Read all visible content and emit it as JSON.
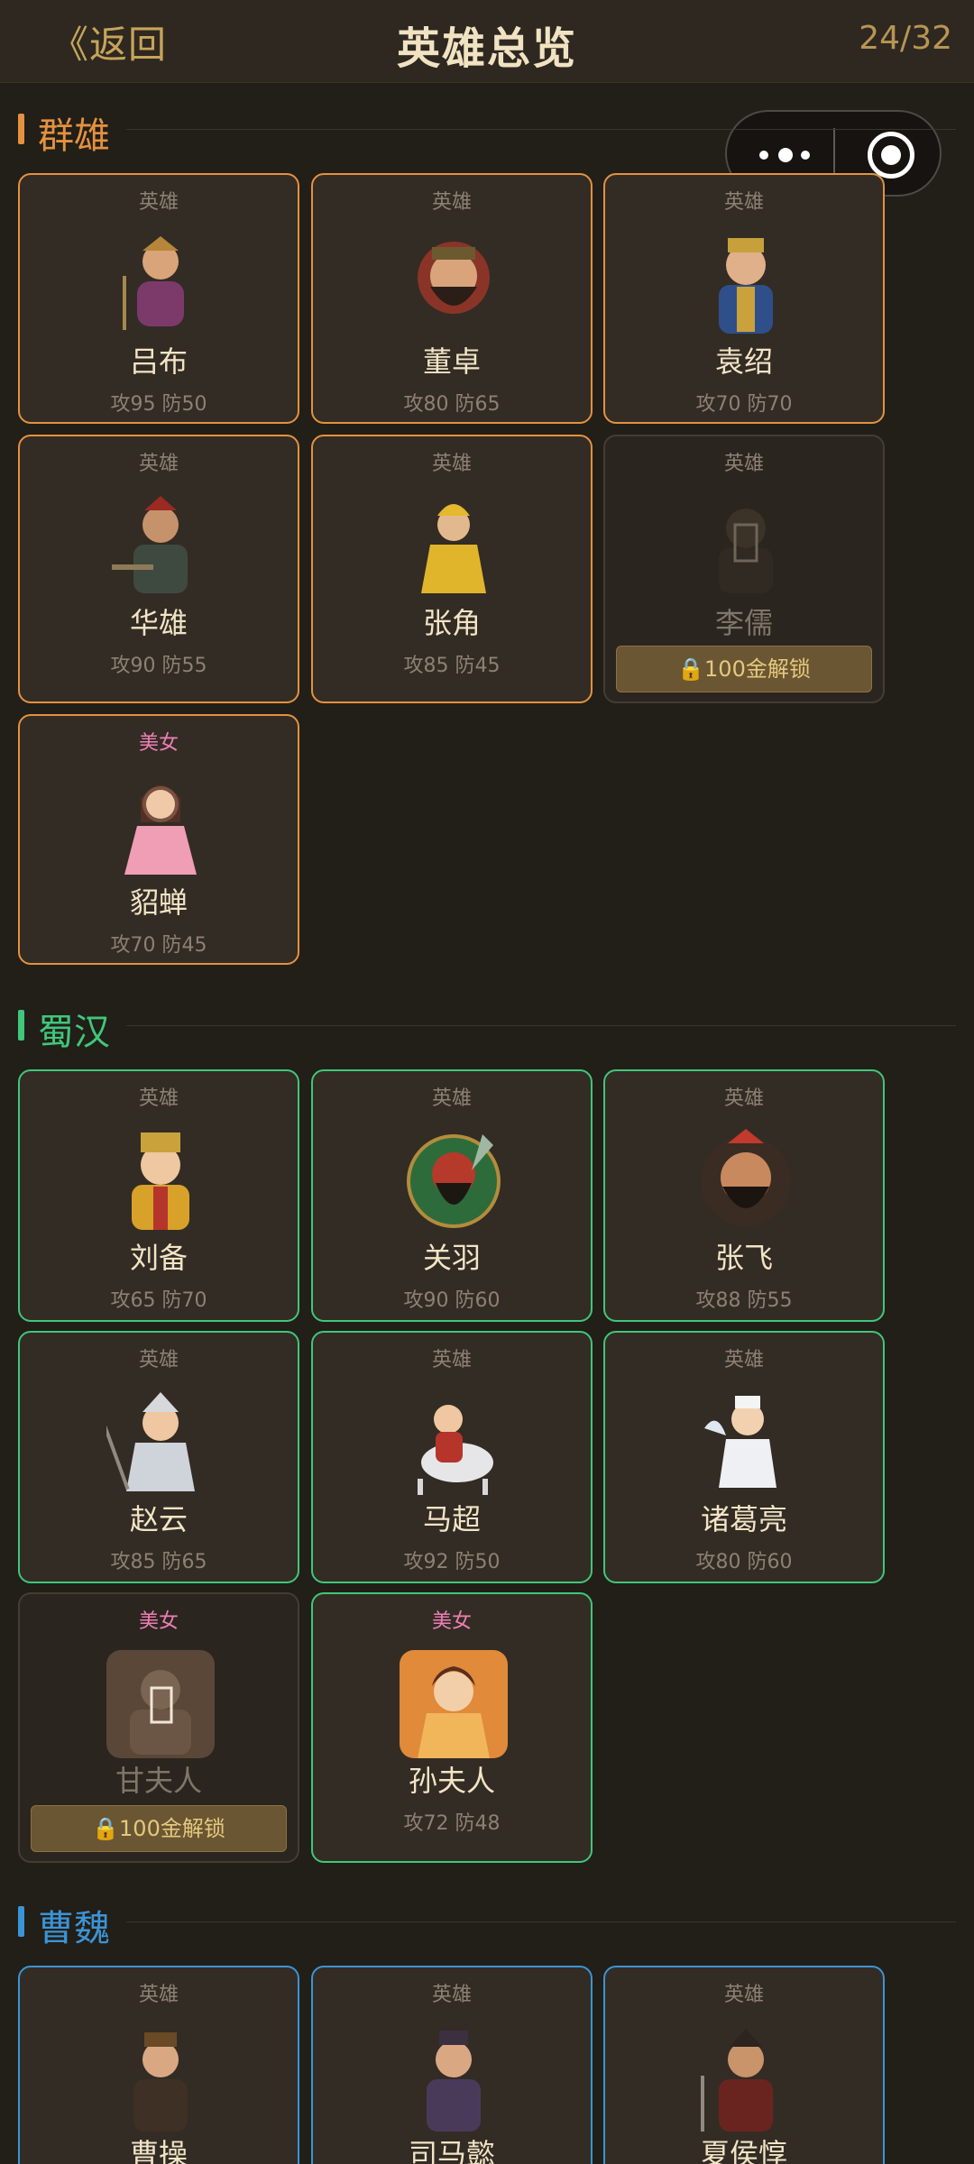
{
  "header": {
    "back_label": "《返回",
    "title": "英雄总览",
    "count": "24/32"
  },
  "sections": [
    {
      "name": "群雄",
      "color": "#e3923f",
      "cards": [
        {
          "tag": "英雄",
          "name": "吕布",
          "stats": "攻95 防50"
        },
        {
          "tag": "英雄",
          "name": "董卓",
          "stats": "攻80 防65"
        },
        {
          "tag": "英雄",
          "name": "袁绍",
          "stats": "攻70 防70"
        },
        {
          "tag": "英雄",
          "name": "华雄",
          "stats": "攻90 防55"
        },
        {
          "tag": "英雄",
          "name": "张角",
          "stats": "攻85 防45"
        },
        {
          "tag": "英雄",
          "name": "李儒",
          "locked": true,
          "unlock_label": "🔒100金解锁"
        },
        {
          "tag": "美女",
          "name": "貂蝉",
          "stats": "攻70 防45"
        }
      ]
    },
    {
      "name": "蜀汉",
      "color": "#3fc77a",
      "cards": [
        {
          "tag": "英雄",
          "name": "刘备",
          "stats": "攻65 防70"
        },
        {
          "tag": "英雄",
          "name": "关羽",
          "stats": "攻90 防60"
        },
        {
          "tag": "英雄",
          "name": "张飞",
          "stats": "攻88 防55"
        },
        {
          "tag": "英雄",
          "name": "赵云",
          "stats": "攻85 防65"
        },
        {
          "tag": "英雄",
          "name": "马超",
          "stats": "攻92 防50"
        },
        {
          "tag": "英雄",
          "name": "诸葛亮",
          "stats": "攻80 防60"
        },
        {
          "tag": "美女",
          "name": "甘夫人",
          "locked": true,
          "unlock_label": "🔒100金解锁"
        },
        {
          "tag": "美女",
          "name": "孙夫人",
          "stats": "攻72 防48"
        }
      ]
    },
    {
      "name": "曹魏",
      "color": "#3b94d6",
      "cards": [
        {
          "tag": "英雄",
          "name": "曹操"
        },
        {
          "tag": "英雄",
          "name": "司马懿"
        },
        {
          "tag": "英雄",
          "name": "夏侯惇"
        }
      ]
    }
  ]
}
